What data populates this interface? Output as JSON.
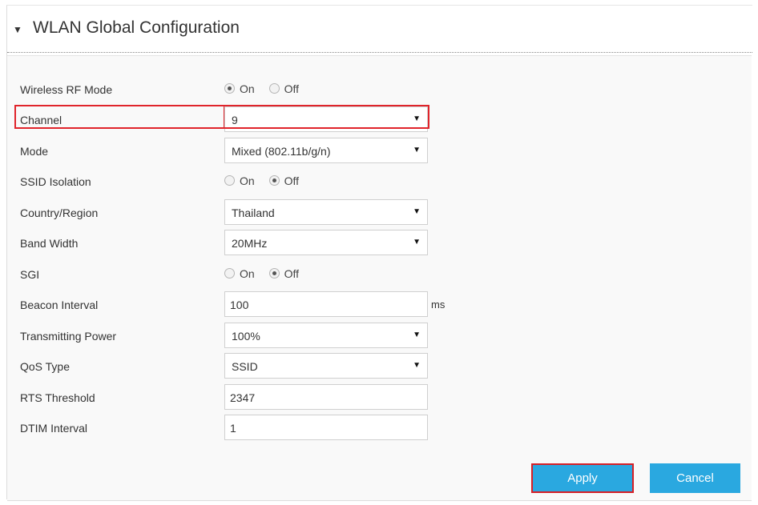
{
  "section": {
    "title": "WLAN Global Configuration"
  },
  "form": {
    "wireless_rf_mode": {
      "label": "Wireless RF Mode",
      "on": "On",
      "off": "Off",
      "selected": "On"
    },
    "channel": {
      "label": "Channel",
      "value": "9"
    },
    "mode": {
      "label": "Mode",
      "value": "Mixed (802.11b/g/n)"
    },
    "ssid_isolation": {
      "label": "SSID Isolation",
      "on": "On",
      "off": "Off",
      "selected": "Off"
    },
    "country_region": {
      "label": "Country/Region",
      "value": "Thailand"
    },
    "band_width": {
      "label": "Band Width",
      "value": "20MHz"
    },
    "sgi": {
      "label": "SGI",
      "on": "On",
      "off": "Off",
      "selected": "Off"
    },
    "beacon_interval": {
      "label": "Beacon Interval",
      "value": "100",
      "unit": "ms"
    },
    "transmitting_power": {
      "label": "Transmitting Power",
      "value": "100%"
    },
    "qos_type": {
      "label": "QoS Type",
      "value": "SSID"
    },
    "rts_threshold": {
      "label": "RTS Threshold",
      "value": "2347"
    },
    "dtim_interval": {
      "label": "DTIM Interval",
      "value": "1"
    }
  },
  "buttons": {
    "apply": "Apply",
    "cancel": "Cancel"
  },
  "colors": {
    "accent": "#2aa8e0",
    "highlight": "#e0242b"
  }
}
